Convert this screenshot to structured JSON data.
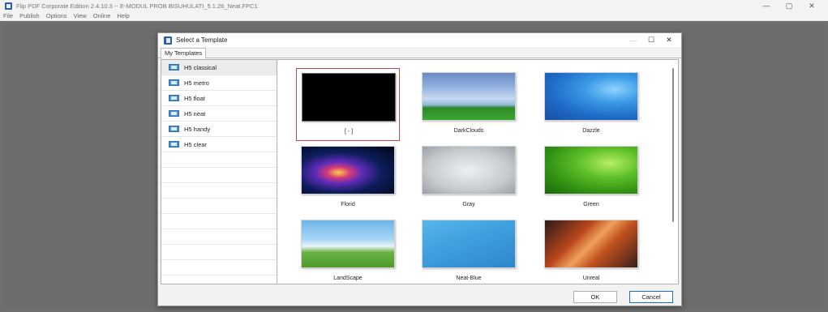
{
  "app": {
    "title": "Flip PDF Corporate Edition 2.4.10.3 -- E-MODUL PROB BISUHULATI_5.1.26_Neat.FPC1",
    "controls": {
      "minimize": "—",
      "maximize": "▢",
      "close": "✕"
    }
  },
  "menu": [
    "File",
    "Publish",
    "Options",
    "View",
    "Online",
    "Help"
  ],
  "dialog": {
    "title": "Select a Template",
    "controls": {
      "minimize": "—",
      "maximize": "☐",
      "close": "✕"
    },
    "tab": "My Templates",
    "templates_list": [
      {
        "label": "H5 classical",
        "selected": true
      },
      {
        "label": "H5 metro",
        "selected": false
      },
      {
        "label": "H5 float",
        "selected": false
      },
      {
        "label": "H5 neat",
        "selected": false
      },
      {
        "label": "H5 handy",
        "selected": false
      },
      {
        "label": "H5 clear",
        "selected": false
      }
    ],
    "themes": [
      {
        "label": "[ - ]",
        "style": "black",
        "selected": true
      },
      {
        "label": "DarkClouds",
        "style": "darkclouds",
        "selected": false
      },
      {
        "label": "Dazzle",
        "style": "dazzle",
        "selected": false
      },
      {
        "label": "Florid",
        "style": "florid",
        "selected": false
      },
      {
        "label": "Gray",
        "style": "gray",
        "selected": false
      },
      {
        "label": "Green",
        "style": "green",
        "selected": false
      },
      {
        "label": "LandScape",
        "style": "landscape",
        "selected": false
      },
      {
        "label": "Neat-Blue",
        "style": "neatblue",
        "selected": false
      },
      {
        "label": "Unreal",
        "style": "unreal",
        "selected": false
      }
    ],
    "buttons": {
      "ok": "OK",
      "cancel": "Cancel"
    }
  }
}
